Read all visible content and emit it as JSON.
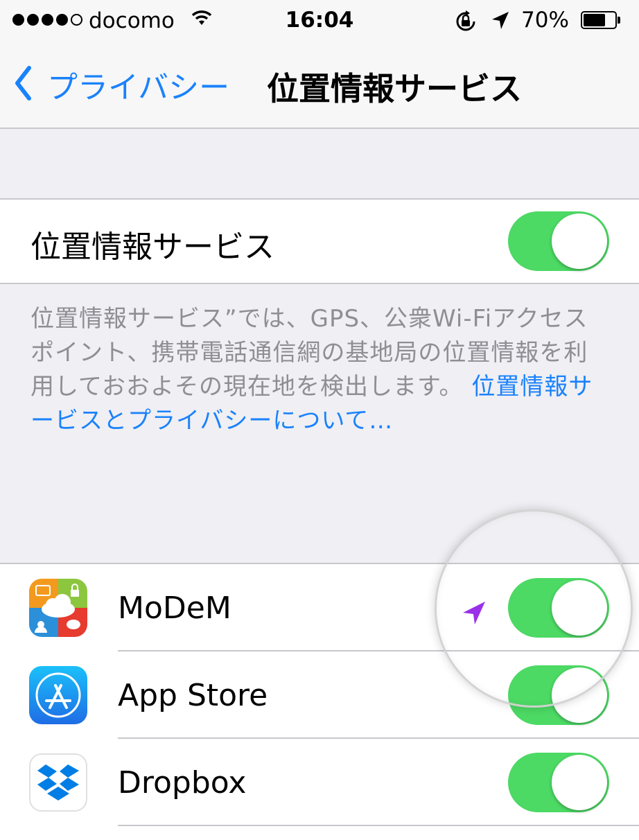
{
  "status_bar": {
    "carrier": "docomo",
    "time": "16:04",
    "battery_percent": "70%",
    "battery_level": 0.7,
    "signal_bars_filled": 4,
    "signal_bars_total": 5,
    "icons": [
      "wifi-icon",
      "rotation-lock-icon",
      "location-arrow-icon",
      "battery-icon"
    ]
  },
  "nav_bar": {
    "back_label": "プライバシー",
    "title": "位置情報サービス",
    "accent_color": "#1a82fb"
  },
  "location_services": {
    "label": "位置情報サービス",
    "enabled": true
  },
  "footer": {
    "text": "位置情報サービス”では、GPS、公衆Wi-Fiアクセスポイント、携帯電話通信網の基地局の位置情報を利用しておおよその現在地を検出します。",
    "link": "位置情報サービスとプライバシーについて…"
  },
  "apps": [
    {
      "name": "MoDeM",
      "enabled": true,
      "location_in_use": true,
      "icon": "modem-app-icon"
    },
    {
      "name": "App Store",
      "enabled": true,
      "location_in_use": false,
      "icon": "app-store-icon"
    },
    {
      "name": "Dropbox",
      "enabled": true,
      "location_in_use": false,
      "icon": "dropbox-icon"
    }
  ],
  "colors": {
    "toggle_on": "#4cd964",
    "link": "#1a82fb",
    "location_arrow": "#9b30e8",
    "footer_text": "#8e8e93"
  }
}
